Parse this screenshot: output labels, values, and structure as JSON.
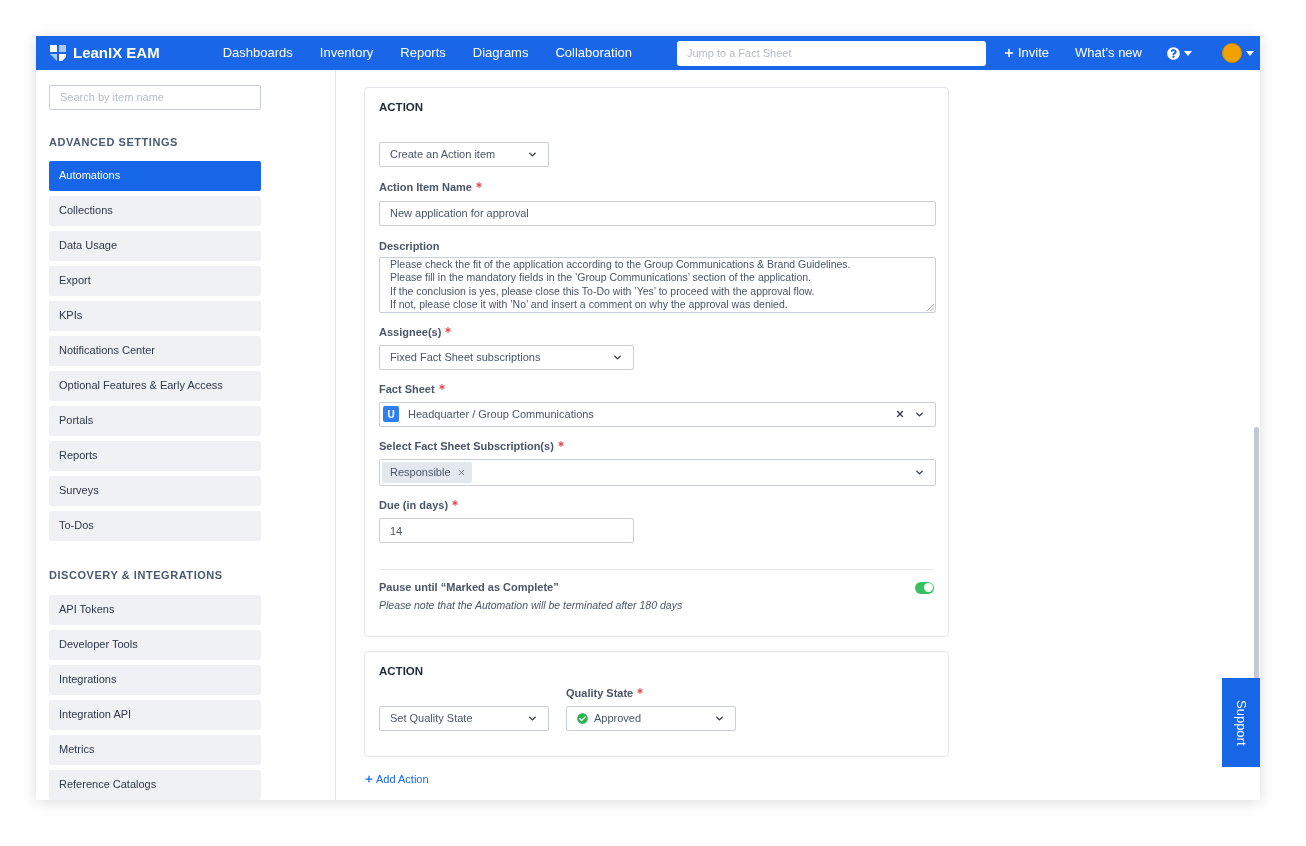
{
  "topbar": {
    "brand": "LeanIX EAM",
    "nav": [
      "Dashboards",
      "Inventory",
      "Reports",
      "Diagrams",
      "Collaboration"
    ],
    "search": {
      "placeholder": "Jump to a Fact Sheet"
    },
    "invite": "Invite",
    "whats_new": "What’s new"
  },
  "sidebar": {
    "search": {
      "placeholder": "Search by item name"
    },
    "sections": [
      {
        "title": "ADVANCED SETTINGS",
        "items": [
          {
            "label": "Automations",
            "selected": true
          },
          {
            "label": "Collections",
            "selected": false
          },
          {
            "label": "Data Usage",
            "selected": false
          },
          {
            "label": "Export",
            "selected": false
          },
          {
            "label": "KPIs",
            "selected": false
          },
          {
            "label": "Notifications Center",
            "selected": false
          },
          {
            "label": "Optional Features & Early Access",
            "selected": false
          },
          {
            "label": "Portals",
            "selected": false
          },
          {
            "label": "Reports",
            "selected": false
          },
          {
            "label": "Surveys",
            "selected": false
          },
          {
            "label": "To-Dos",
            "selected": false
          }
        ]
      },
      {
        "title": "DISCOVERY & INTEGRATIONS",
        "items": [
          {
            "label": "API Tokens",
            "selected": false
          },
          {
            "label": "Developer Tools",
            "selected": false
          },
          {
            "label": "Integrations",
            "selected": false
          },
          {
            "label": "Integration API",
            "selected": false
          },
          {
            "label": "Metrics",
            "selected": false
          },
          {
            "label": "Reference Catalogs",
            "selected": false
          }
        ]
      }
    ]
  },
  "action_cards": [
    {
      "kind": "action_item",
      "title": "ACTION",
      "action_type": "Create an Action item",
      "item_name": {
        "label": "Action Item Name",
        "required": true,
        "value": "New application for approval"
      },
      "description": {
        "label": "Description",
        "lines": [
          "Please check the fit of the application according to the Group Communications & Brand Guidelines.",
          "Please fill in the mandatory fields in the ’Group Communications’ section of the application.",
          "If the conclusion is yes, please close this To-Do with ’Yes’ to proceed with the approval flow.",
          "If not, please close it with ’No’ and insert a comment on why the approval was denied."
        ]
      },
      "assignees": {
        "label": "Assignee(s)",
        "required": true,
        "value": "Fixed Fact Sheet subscriptions"
      },
      "fact_sheet": {
        "label": "Fact Sheet",
        "required": true,
        "type_badge": "U",
        "value": "Headquarter / Group Communications"
      },
      "subscriptions": {
        "label": "Select Fact Sheet Subscription(s)",
        "required": true,
        "tags": [
          "Responsible"
        ]
      },
      "due": {
        "label": "Due (in days)",
        "required": true,
        "value": "14"
      },
      "pause": {
        "label": "Pause until “Marked as Complete”",
        "on": true,
        "note": "Please note that the Automation will be terminated after 180 days"
      }
    },
    {
      "kind": "quality_state",
      "title": "ACTION",
      "action_type": "Set Quality State",
      "quality_state": {
        "label": "Quality State",
        "required": true,
        "value": "Approved"
      }
    }
  ],
  "add_action": "Add Action",
  "support": "Support"
}
